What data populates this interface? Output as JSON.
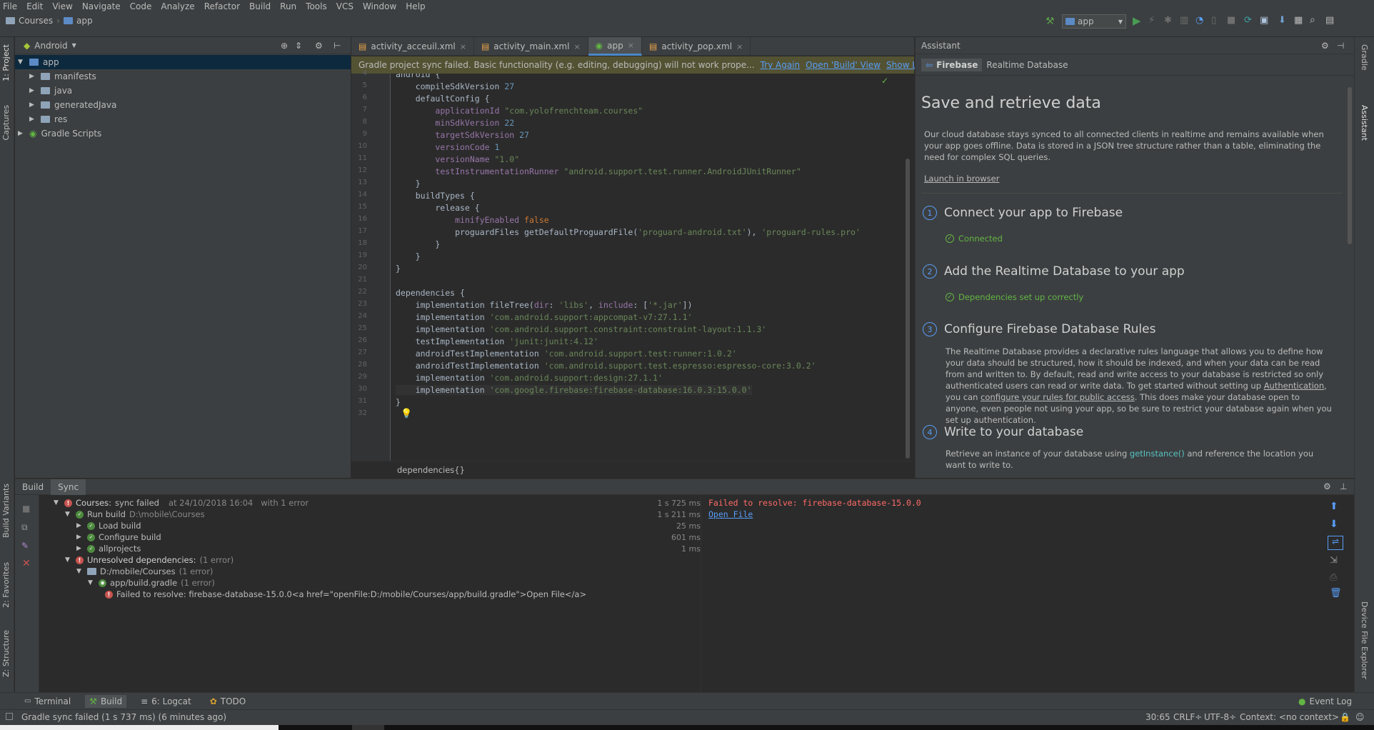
{
  "menubar": [
    "File",
    "Edit",
    "View",
    "Navigate",
    "Code",
    "Analyze",
    "Refactor",
    "Build",
    "Run",
    "Tools",
    "VCS",
    "Window",
    "Help"
  ],
  "navbar": {
    "breadcrumb": [
      "Courses",
      "app"
    ],
    "run_config": "app"
  },
  "left_strip": {
    "project": "1: Project",
    "captures": "Captures",
    "build_variants": "Build Variants",
    "favorites": "2: Favorites",
    "structure": "Z: Structure"
  },
  "right_strip": {
    "gradle": "Gradle",
    "assistant": "Assistant",
    "device_explorer": "Device File Explorer"
  },
  "project": {
    "view": "Android",
    "tree": [
      {
        "label": "app",
        "level": 0,
        "expanded": true
      },
      {
        "label": "manifests",
        "level": 1
      },
      {
        "label": "java",
        "level": 1
      },
      {
        "label": "generatedJava",
        "level": 1
      },
      {
        "label": "res",
        "level": 1
      },
      {
        "label": "Gradle Scripts",
        "level": 0
      }
    ]
  },
  "editor": {
    "tabs": [
      {
        "label": "activity_acceuil.xml"
      },
      {
        "label": "activity_main.xml"
      },
      {
        "label": "app",
        "active": true
      },
      {
        "label": "activity_pop.xml"
      }
    ],
    "banner": {
      "message": "Gradle project sync failed. Basic functionality (e.g. editing, debugging) will not work prope...",
      "links": [
        "Try Again",
        "Open 'Build' View",
        "Show Log in Explorer"
      ]
    },
    "lines": [
      {
        "n": "4",
        "text": "android {"
      },
      {
        "n": "5",
        "text": "    compileSdkVersion 27"
      },
      {
        "n": "6",
        "text": "    defaultConfig {"
      },
      {
        "n": "7",
        "text": "        applicationId \"com.yolofrenchteam.courses\""
      },
      {
        "n": "8",
        "text": "        minSdkVersion 22"
      },
      {
        "n": "9",
        "text": "        targetSdkVersion 27"
      },
      {
        "n": "10",
        "text": "        versionCode 1"
      },
      {
        "n": "11",
        "text": "        versionName \"1.0\""
      },
      {
        "n": "12",
        "text": "        testInstrumentationRunner \"android.support.test.runner.AndroidJUnitRunner\""
      },
      {
        "n": "13",
        "text": "    }"
      },
      {
        "n": "14",
        "text": "    buildTypes {"
      },
      {
        "n": "15",
        "text": "        release {"
      },
      {
        "n": "16",
        "text": "            minifyEnabled false"
      },
      {
        "n": "17",
        "text": "            proguardFiles getDefaultProguardFile('proguard-android.txt'), 'proguard-rules.pro'"
      },
      {
        "n": "18",
        "text": "        }"
      },
      {
        "n": "19",
        "text": "    }"
      },
      {
        "n": "20",
        "text": "}"
      },
      {
        "n": "21",
        "text": ""
      },
      {
        "n": "22",
        "text": "dependencies {"
      },
      {
        "n": "23",
        "text": "    implementation fileTree(dir: 'libs', include: ['*.jar'])"
      },
      {
        "n": "24",
        "text": "    implementation 'com.android.support:appcompat-v7:27.1.1'"
      },
      {
        "n": "25",
        "text": "    implementation 'com.android.support.constraint:constraint-layout:1.1.3'"
      },
      {
        "n": "26",
        "text": "    testImplementation 'junit:junit:4.12'"
      },
      {
        "n": "27",
        "text": "    androidTestImplementation 'com.android.support.test:runner:1.0.2'"
      },
      {
        "n": "28",
        "text": "    androidTestImplementation 'com.android.support.test.espresso:espresso-core:3.0.2'"
      },
      {
        "n": "29",
        "text": "    implementation 'com.android.support:design:27.1.1'"
      },
      {
        "n": "30",
        "text": "    implementation 'com.google.firebase:firebase-database:16.0.3:15.0.0'"
      },
      {
        "n": "31",
        "text": "}"
      },
      {
        "n": "32",
        "text": ""
      }
    ],
    "breadcrumb": "dependencies{}"
  },
  "assistant": {
    "title": "Assistant",
    "nav": {
      "root": "Firebase",
      "page": "Realtime Database"
    },
    "heading": "Save and retrieve data",
    "intro": "Our cloud database stays synced to all connected clients in realtime and remains available when your app goes offline. Data is stored in a JSON tree structure rather than a table, eliminating the need for complex SQL queries.",
    "launch": "Launch in browser",
    "steps": [
      {
        "num": "1",
        "title": "Connect your app to Firebase",
        "status": "Connected"
      },
      {
        "num": "2",
        "title": "Add the Realtime Database to your app",
        "status": "Dependencies set up correctly"
      },
      {
        "num": "3",
        "title": "Configure Firebase Database Rules"
      },
      {
        "num": "4",
        "title": "Write to your database"
      }
    ],
    "rules_text_1": "The Realtime Database provides a declarative rules language that allows you to define how your data should be structured, how it should be indexed, and when your data can be read from and written to. By default, read and write access to your database is restricted so only authenticated users can read or write data. To get started without setting up",
    "rules_link_auth": "Authentication",
    "rules_text_2": ", you can",
    "rules_link_public": "configure your rules for public access",
    "rules_text_3": ". This does make your database open to anyone, even people not using your app, so be sure to restrict your database again when you set up authentication.",
    "write_text_1": "Retrieve an instance of your database using",
    "write_code": "getInstance()",
    "write_text_2": "and reference the location you want to write to."
  },
  "build": {
    "tabs": [
      "Build",
      "Sync"
    ],
    "rows": [
      {
        "label": "Courses:",
        "extra": "sync failed",
        "meta": "at 24/10/2018 16:04",
        "meta2": "with 1 error",
        "time": "1 s 725 ms"
      },
      {
        "label": "Run build",
        "meta": "D:\\mobile\\Courses",
        "time": "1 s 211 ms"
      },
      {
        "label": "Load build",
        "time": "25 ms"
      },
      {
        "label": "Configure build",
        "time": "601 ms"
      },
      {
        "label": "allprojects",
        "time": "1 ms"
      },
      {
        "label": "Unresolved dependencies:",
        "meta": "(1 error)"
      },
      {
        "label": "D:/mobile/Courses",
        "meta": "(1 error)"
      },
      {
        "label": "app/build.gradle",
        "meta": "(1 error)"
      },
      {
        "label": "Failed to resolve: firebase-database-15.0.0<a href=\"openFile:D:/mobile/Courses/app/build.gradle\">Open File</a>"
      }
    ],
    "output": {
      "error": "Failed to resolve: firebase-database-15.0.0",
      "link": "Open File"
    }
  },
  "bottom_tools": [
    "Terminal",
    "Build",
    "6: Logcat",
    "TODO"
  ],
  "event_log": "Event Log",
  "status": {
    "message": "Gradle sync failed (1 s 737 ms) (6 minutes ago)",
    "position": "30:65",
    "line_sep": "CRLF÷",
    "encoding": "UTF-8÷",
    "context": "Context: <no context>"
  }
}
